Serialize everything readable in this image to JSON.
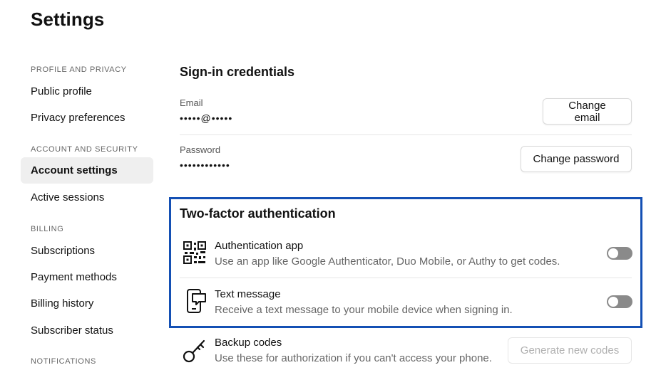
{
  "page": {
    "title": "Settings"
  },
  "sidebar": {
    "sections": [
      {
        "label": "PROFILE AND PRIVACY",
        "items": [
          {
            "label": "Public profile"
          },
          {
            "label": "Privacy preferences"
          }
        ]
      },
      {
        "label": "ACCOUNT AND SECURITY",
        "items": [
          {
            "label": "Account settings",
            "active": true
          },
          {
            "label": "Active sessions"
          }
        ]
      },
      {
        "label": "BILLING",
        "items": [
          {
            "label": "Subscriptions"
          },
          {
            "label": "Payment methods"
          },
          {
            "label": "Billing history"
          },
          {
            "label": "Subscriber status"
          }
        ]
      },
      {
        "label": "NOTIFICATIONS",
        "items": []
      }
    ]
  },
  "signin": {
    "title": "Sign-in credentials",
    "email": {
      "label": "Email",
      "value": "•••••@•••••",
      "button": "Change email"
    },
    "password": {
      "label": "Password",
      "value": "••••••••••••",
      "button": "Change password"
    }
  },
  "two_factor": {
    "title": "Two-factor authentication",
    "options": [
      {
        "title": "Authentication app",
        "description": "Use an app like Google Authenticator, Duo Mobile, or Authy to get codes.",
        "icon": "qr-code-icon",
        "enabled": false
      },
      {
        "title": "Text message",
        "description": "Receive a text message to your mobile device when signing in.",
        "icon": "phone-message-icon",
        "enabled": false
      }
    ]
  },
  "backup": {
    "title": "Backup codes",
    "description": "Use these for authorization if you can't access your phone.",
    "icon": "key-icon",
    "button": "Generate new codes"
  },
  "colors": {
    "highlight_border": "#1450b4",
    "toggle_off": "#8a8a8a",
    "active_nav_bg": "#efefef"
  }
}
